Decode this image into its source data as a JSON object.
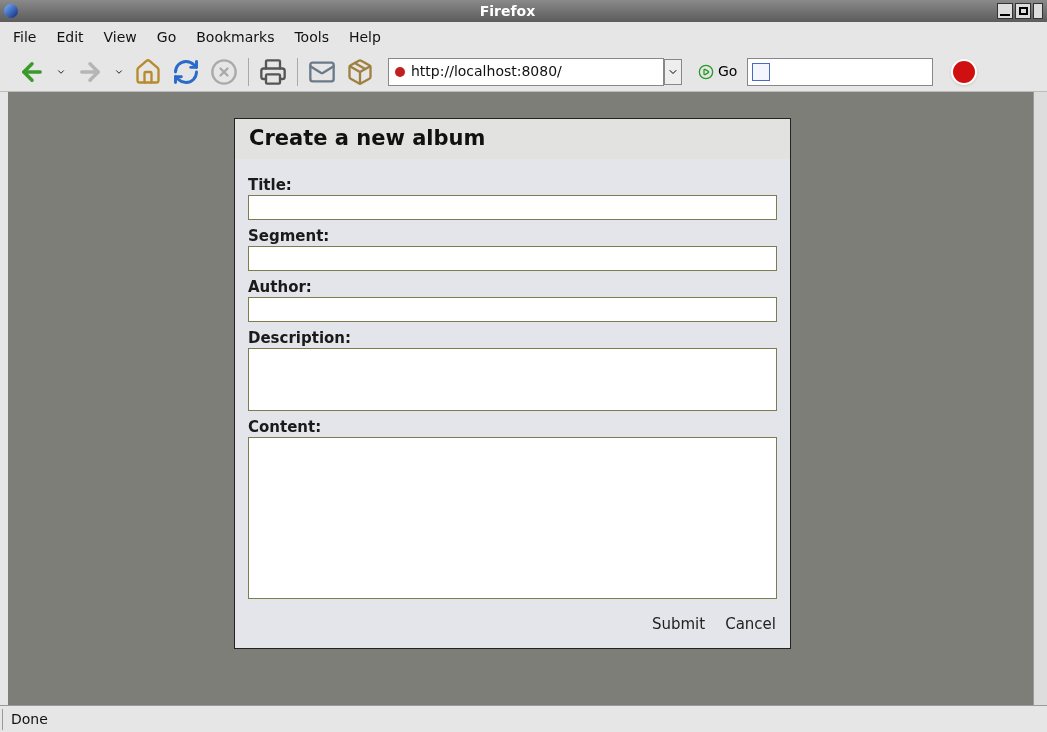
{
  "window": {
    "title": "Firefox"
  },
  "menu": [
    "File",
    "Edit",
    "View",
    "Go",
    "Bookmarks",
    "Tools",
    "Help"
  ],
  "toolbar": {
    "url": "http://localhost:8080/",
    "go": "Go"
  },
  "dialog": {
    "title": "Create a new album",
    "fields": [
      {
        "label": "Title:",
        "kind": "input"
      },
      {
        "label": "Segment:",
        "kind": "input"
      },
      {
        "label": "Author:",
        "kind": "input"
      },
      {
        "label": "Description:",
        "kind": "textarea"
      },
      {
        "label": "Content:",
        "kind": "bigtextarea"
      }
    ],
    "buttons": [
      "Submit",
      "Cancel"
    ]
  },
  "status_bar": "Done"
}
